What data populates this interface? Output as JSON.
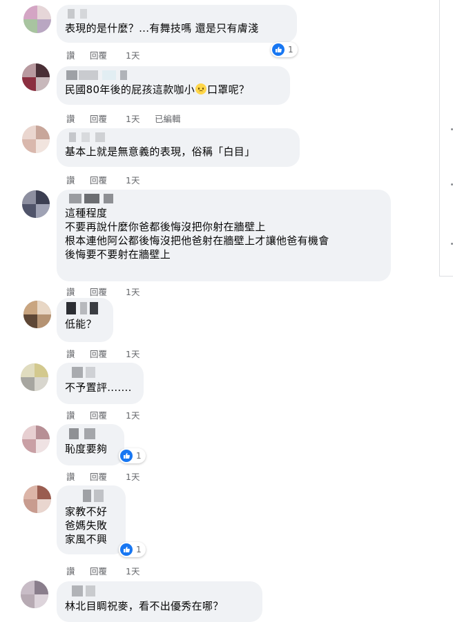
{
  "comments": [
    {
      "lines": [
        "表現的是什麼？...有舞技嗎 還是只有膚淺"
      ],
      "actions": [
        "讚",
        "回覆",
        "1天"
      ],
      "reaction_count": "1"
    },
    {
      "before_emoji": "民國80年後的屁孩這款咖小",
      "after_emoji": "口罩呢？",
      "emoji": "disappointed-emoji",
      "actions": [
        "讚",
        "回覆",
        "1天",
        "已編輯"
      ]
    },
    {
      "lines": [
        "基本上就是無意義的表現，俗稱「白目」"
      ],
      "actions": [
        "讚",
        "回覆",
        "1天"
      ]
    },
    {
      "lines": [
        "這種程度",
        "不要再說什麼你爸都後悔沒把你射在牆壁上",
        "根本連他阿公都後悔沒把他爸射在牆壁上才讓他爸有機會",
        "後悔要不要射在牆壁上"
      ],
      "actions": [
        "讚",
        "回覆",
        "1天"
      ]
    },
    {
      "lines": [
        "低能？"
      ],
      "actions": [
        "讚",
        "回覆",
        "1天"
      ]
    },
    {
      "lines": [
        "不予置評......."
      ],
      "actions": [
        "讚",
        "回覆",
        "1天"
      ]
    },
    {
      "lines": [
        "恥度要夠"
      ],
      "actions": [
        "讚",
        "回覆",
        "1天"
      ],
      "reaction_count": "1"
    },
    {
      "lines": [
        "家教不好",
        "爸媽失敗",
        "家風不興"
      ],
      "actions": [
        "讚",
        "回覆",
        "1天"
      ],
      "reaction_count": "1"
    },
    {
      "lines": [
        "林北目睭祝麥，看不出優秀在哪？"
      ]
    }
  ],
  "colors": {
    "bubble": "#f0f2f5",
    "like": "#1877f2",
    "meta": "#65676b"
  },
  "icons": [
    "like-icon",
    "disappointed-emoji"
  ]
}
